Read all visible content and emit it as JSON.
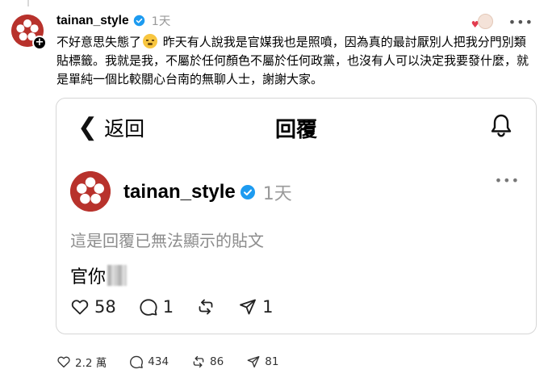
{
  "post": {
    "username": "tainan_style",
    "time": "1天",
    "text_before_emoji": "不好意思失態了",
    "text_after_emoji": " 昨天有人說我是官媒我也是照噴，因為真的最討厭別人把我分門別類貼標籤。我就是我，不屬於任何顏色不屬於任何政黨，也沒有人可以決定我要發什麼，就是單純一個比較關心台南的無聊人士，謝謝大家。"
  },
  "card": {
    "back_label": "返回",
    "title": "回覆",
    "username": "tainan_style",
    "time": "1天",
    "unavailable_text": "這是回覆已無法顯示的貼文",
    "reply_text": "官你",
    "likes": "58",
    "comments": "1",
    "shares": "1"
  },
  "footer": {
    "likes": "2.2 萬",
    "comments": "434",
    "reposts": "86",
    "shares": "81"
  },
  "colors": {
    "brand_red": "#b8322c",
    "verified_blue": "#1d9bf0",
    "muted": "#9a9a9a"
  }
}
